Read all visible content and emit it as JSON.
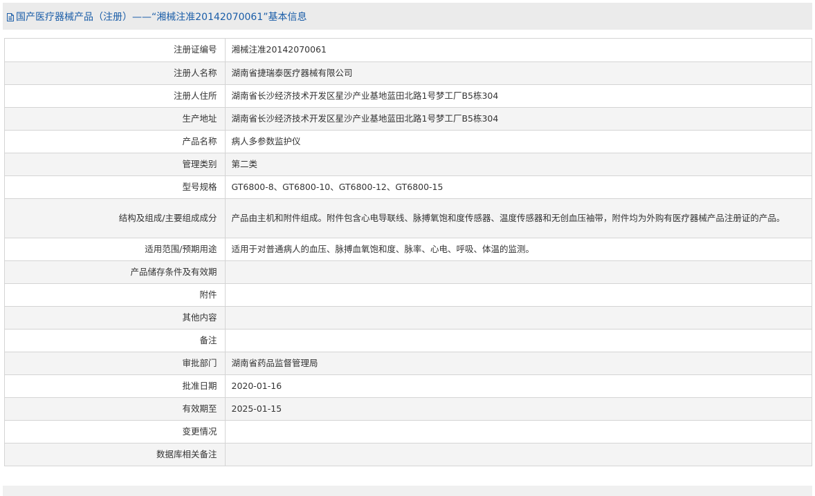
{
  "header": {
    "title": "国产医疗器械产品（注册）——“湘械注准20142070061”基本信息",
    "icon": "document-icon"
  },
  "rows": [
    {
      "label": "注册证编号",
      "value": "湘械注准20142070061"
    },
    {
      "label": "注册人名称",
      "value": "湖南省捷瑞泰医疗器械有限公司"
    },
    {
      "label": "注册人住所",
      "value": "湖南省长沙经济技术开发区星沙产业基地蓝田北路1号梦工厂B5栋304"
    },
    {
      "label": "生产地址",
      "value": "湖南省长沙经济技术开发区星沙产业基地蓝田北路1号梦工厂B5栋304"
    },
    {
      "label": "产品名称",
      "value": "病人多参数监护仪"
    },
    {
      "label": "管理类别",
      "value": "第二类"
    },
    {
      "label": "型号规格",
      "value": "GT6800-8、GT6800-10、GT6800-12、GT6800-15"
    },
    {
      "label": "结构及组成/主要组成成分",
      "value": "产品由主机和附件组成。附件包含心电导联线、脉搏氧饱和度传感器、温度传感器和无创血压袖带，附件均为外购有医疗器械产品注册证的产品。"
    },
    {
      "label": "适用范围/预期用途",
      "value": "适用于对普通病人的血压、脉搏血氧饱和度、脉率、心电、呼吸、体温的监测。"
    },
    {
      "label": "产品储存条件及有效期",
      "value": ""
    },
    {
      "label": "附件",
      "value": ""
    },
    {
      "label": "其他内容",
      "value": ""
    },
    {
      "label": "备注",
      "value": ""
    },
    {
      "label": "审批部门",
      "value": "湖南省药品监督管理局"
    },
    {
      "label": "批准日期",
      "value": "2020-01-16"
    },
    {
      "label": "有效期至",
      "value": "2025-01-15"
    },
    {
      "label": "变更情况",
      "value": ""
    },
    {
      "label": "数据库相关备注",
      "value": ""
    }
  ],
  "colors": {
    "title_text": "#1a5da8",
    "title_bar_bg": "#ebebeb",
    "border": "#d4d4d4",
    "row_alt_bg": "#f4f4f4"
  }
}
